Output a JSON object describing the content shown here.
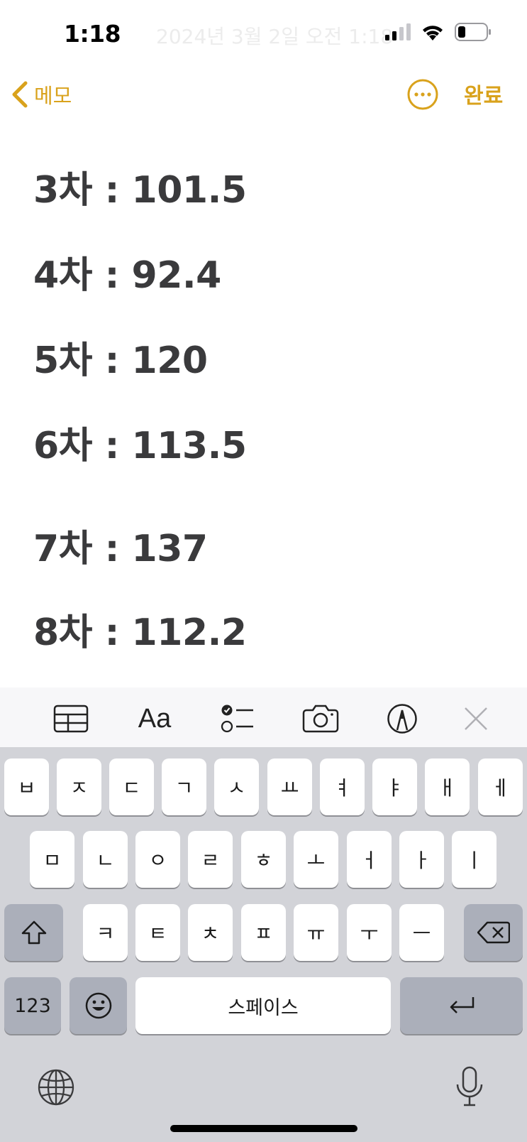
{
  "status_bar": {
    "time": "1:18",
    "date_overlay": "2024년 3월 2일 오전 1:18"
  },
  "nav": {
    "back_label": "메모",
    "done_label": "완료",
    "accent_color": "#d9a21c"
  },
  "note": {
    "lines": [
      "3차 : 101.5",
      "4차 : 92.4",
      "5차 : 120",
      "6차 : 113.5",
      "7차 : 137",
      "8차 : 112.2"
    ]
  },
  "toolbar": {
    "format_label": "Aa",
    "icons": [
      "table-icon",
      "text-format-icon",
      "checklist-icon",
      "camera-icon",
      "markup-icon",
      "close-icon"
    ]
  },
  "keyboard": {
    "row1": [
      "ㅂ",
      "ㅈ",
      "ㄷ",
      "ㄱ",
      "ㅅ",
      "ㅛ",
      "ㅕ",
      "ㅑ",
      "ㅐ",
      "ㅔ"
    ],
    "row2": [
      "ㅁ",
      "ㄴ",
      "ㅇ",
      "ㄹ",
      "ㅎ",
      "ㅗ",
      "ㅓ",
      "ㅏ",
      "ㅣ"
    ],
    "row3": [
      "ㅋ",
      "ㅌ",
      "ㅊ",
      "ㅍ",
      "ㅠ",
      "ㅜ",
      "ㅡ"
    ],
    "numbers_label": "123",
    "space_label": "스페이스"
  }
}
